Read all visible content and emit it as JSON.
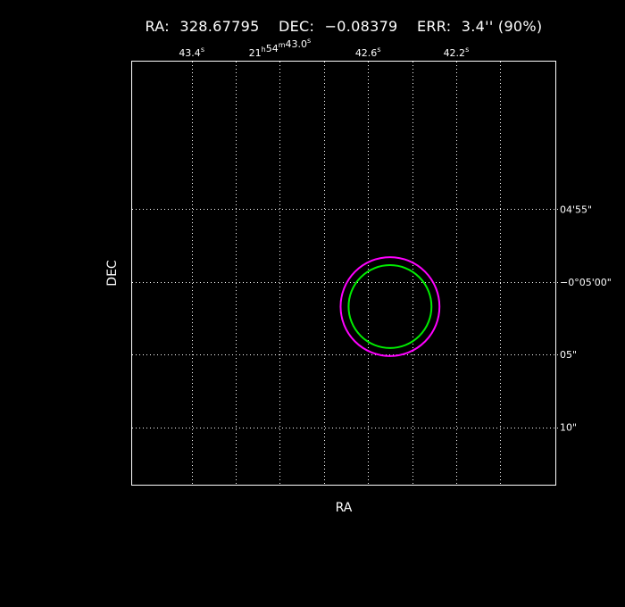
{
  "header": {
    "ra_label": "RA:",
    "ra_value": "328.67795",
    "dec_label": "DEC:",
    "dec_value": "−0.08379",
    "err_label": "ERR:",
    "err_value": "3.4'' (90%)"
  },
  "chart_data": {
    "type": "scatter",
    "title": "RA: 328.67795   DEC: −0.08379   ERR: 3.4'' (90%)",
    "xlabel": "RA",
    "ylabel": "DEC",
    "grid": true,
    "x_ticks": [
      {
        "main": "43.4",
        "sup": "s",
        "offset_s": 0.8
      },
      {
        "main": "21",
        "sup": "h",
        "main2": "54",
        "sup2": "m",
        "main3": "43.0",
        "sup3": "s",
        "offset_s": 0.4
      },
      {
        "main": "42.6",
        "sup": "s",
        "offset_s": 0.0
      },
      {
        "main": "42.2",
        "sup": "s",
        "offset_s": -0.4
      }
    ],
    "x_minor_offsets_s": [
      0.6,
      0.2,
      -0.2,
      -0.6
    ],
    "y_ticks": [
      {
        "label": "04'55\"",
        "dec_arcsec": -295
      },
      {
        "label": "−0°05'00\"",
        "dec_arcsec": -300
      },
      {
        "label": "05\"",
        "dec_arcsec": -305
      },
      {
        "label": "10\"",
        "dec_arcsec": -310
      }
    ],
    "xlim_offset_s": [
      1.07,
      -0.85
    ],
    "ylim_dec_arcsec": [
      -284.85,
      -313.95
    ],
    "series": [
      {
        "shape": "circle",
        "color": "#ff00ff",
        "center_offset_s": -0.1,
        "center_dec_arcsec": -301.7,
        "radius_arcsec": 3.4
      },
      {
        "shape": "circle",
        "color": "#00ee00",
        "center_offset_s": -0.1,
        "center_dec_arcsec": -301.7,
        "radius_arcsec": 2.85
      }
    ]
  }
}
